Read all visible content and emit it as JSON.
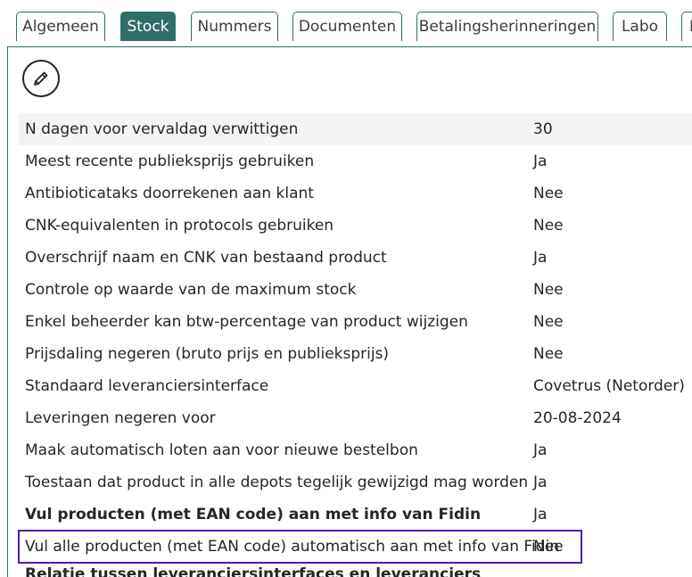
{
  "tabs": [
    {
      "label": "Algemeen",
      "active": false
    },
    {
      "label": "Stock",
      "active": true
    },
    {
      "label": "Nummers",
      "active": false
    },
    {
      "label": "Documenten",
      "active": false
    },
    {
      "label": "Betalingsherinneringen",
      "active": false
    },
    {
      "label": "Labo",
      "active": false
    },
    {
      "label": "B",
      "active": false
    }
  ],
  "edit_icon": "pencil-icon",
  "settings": [
    {
      "label": "N dagen voor vervaldag verwittigen",
      "value": "30"
    },
    {
      "label": "Meest recente publieksprijs gebruiken",
      "value": "Ja"
    },
    {
      "label": "Antibioticataks doorrekenen aan klant",
      "value": "Nee"
    },
    {
      "label": "CNK-equivalenten in protocols gebruiken",
      "value": "Nee"
    },
    {
      "label": "Overschrijf naam en CNK van bestaand product",
      "value": "Ja"
    },
    {
      "label": "Controle op waarde van de maximum stock",
      "value": "Nee"
    },
    {
      "label": "Enkel beheerder kan btw-percentage van product wijzigen",
      "value": "Nee"
    },
    {
      "label": "Prijsdaling negeren (bruto prijs en publieksprijs)",
      "value": "Nee"
    },
    {
      "label": "Standaard leveranciersinterface",
      "value": "Covetrus (Netorder)"
    },
    {
      "label": "Leveringen negeren voor",
      "value": "20-08-2024"
    },
    {
      "label": "Maak automatisch loten aan voor nieuwe bestelbon",
      "value": "Ja"
    },
    {
      "label": "Toestaan dat product in alle depots tegelijk gewijzigd mag worden",
      "value": "Ja"
    },
    {
      "label": "Vul producten (met EAN code) aan met info van Fidin",
      "value": "Ja"
    },
    {
      "label": "Vul alle producten (met EAN code) automatisch aan met info van Fidin",
      "value": "Nee"
    }
  ],
  "section_heading": "Relatie tussen leveranciersinterfaces en leveranciers",
  "colors": {
    "accent": "#2e6e68",
    "highlight_border": "#4b1fa8"
  }
}
